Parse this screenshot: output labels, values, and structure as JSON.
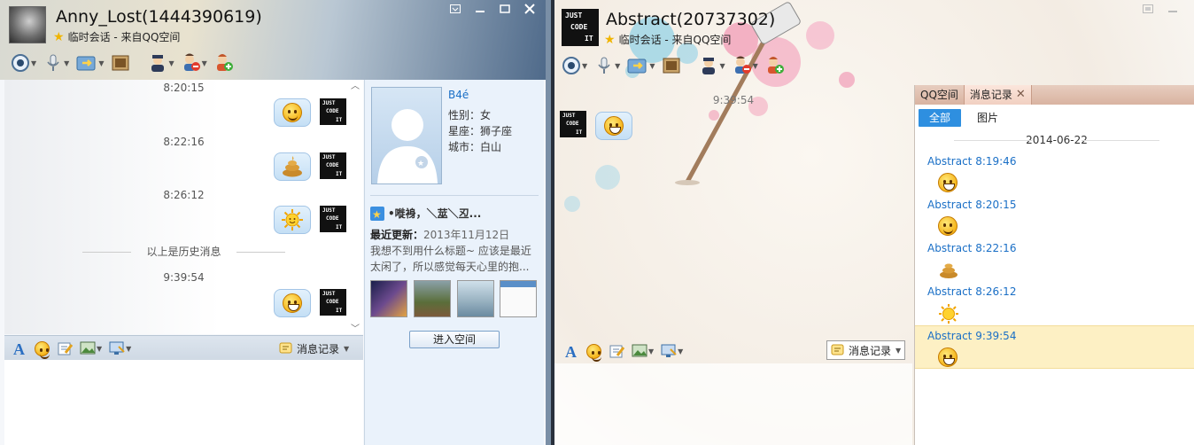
{
  "left_window": {
    "title": "Anny_Lost(1444390619)",
    "subtitle": "临时会话 - 来自QQ空间",
    "toolbar_icons": [
      "video-call-icon",
      "voice-call-icon",
      "send-file-icon",
      "screen-frame-icon",
      "contact-icon",
      "remove-contact-icon",
      "add-contact-icon"
    ],
    "messages": [
      {
        "time": "8:20:15",
        "emoji": "wink"
      },
      {
        "time": "8:22:16",
        "emoji": "poop"
      },
      {
        "time": "8:26:12",
        "emoji": "sun"
      }
    ],
    "history_divider": "以上是历史消息",
    "new_messages": [
      {
        "time": "9:39:54",
        "emoji": "grin"
      }
    ],
    "sender_logo": [
      "JUST",
      "CODE",
      "IT"
    ],
    "input_toolbar": {
      "msg_record_label": "消息记录"
    },
    "profile": {
      "name": "B4é",
      "gender": "性别：女",
      "zodiac": "星座：狮子座",
      "city": "城市：白山",
      "space_title": "•嘥裑，＼莁＼丒...",
      "update_label": "最近更新：",
      "update_date": "2013年11月12日",
      "update_text": "我想不到用什么标题~ 应该是最近太闲了，所以感觉每天心里的抱...",
      "enter_space_label": "进入空间"
    }
  },
  "right_window": {
    "title": "Abstract(20737302)",
    "subtitle": "临时会话 - 来自QQ空间",
    "chat_time": "9:39:54",
    "input_toolbar": {
      "msg_record_label": "消息记录"
    },
    "history_panel": {
      "tabs": [
        "QQ空间",
        "消息记录"
      ],
      "filter_all": "全部",
      "filter_images": "图片",
      "date": "2014-06-22",
      "entries": [
        {
          "sender": "Abstract 8:19:46",
          "emoji": "grin"
        },
        {
          "sender": "Abstract 8:20:15",
          "emoji": "wink"
        },
        {
          "sender": "Abstract 8:22:16",
          "emoji": "poop"
        },
        {
          "sender": "Abstract 8:26:12",
          "emoji": "sun"
        },
        {
          "sender": "Abstract 9:39:54",
          "emoji": "grin"
        }
      ]
    }
  },
  "colors": {
    "bubble": "#c4dff5",
    "selected_entry": "#fdf0c4",
    "filter_active": "#2e8fe0",
    "sender_link": "#1a6fc6"
  }
}
